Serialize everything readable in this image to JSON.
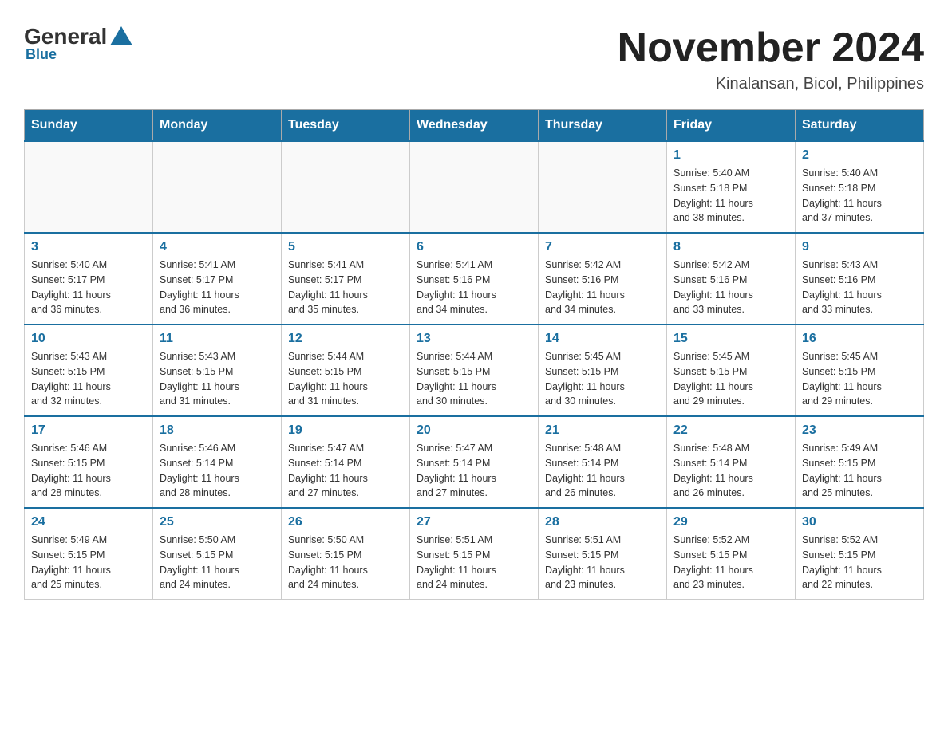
{
  "logo": {
    "general": "General",
    "blue": "Blue"
  },
  "title": "November 2024",
  "subtitle": "Kinalansan, Bicol, Philippines",
  "weekdays": [
    "Sunday",
    "Monday",
    "Tuesday",
    "Wednesday",
    "Thursday",
    "Friday",
    "Saturday"
  ],
  "weeks": [
    [
      {
        "day": "",
        "info": ""
      },
      {
        "day": "",
        "info": ""
      },
      {
        "day": "",
        "info": ""
      },
      {
        "day": "",
        "info": ""
      },
      {
        "day": "",
        "info": ""
      },
      {
        "day": "1",
        "info": "Sunrise: 5:40 AM\nSunset: 5:18 PM\nDaylight: 11 hours\nand 38 minutes."
      },
      {
        "day": "2",
        "info": "Sunrise: 5:40 AM\nSunset: 5:18 PM\nDaylight: 11 hours\nand 37 minutes."
      }
    ],
    [
      {
        "day": "3",
        "info": "Sunrise: 5:40 AM\nSunset: 5:17 PM\nDaylight: 11 hours\nand 36 minutes."
      },
      {
        "day": "4",
        "info": "Sunrise: 5:41 AM\nSunset: 5:17 PM\nDaylight: 11 hours\nand 36 minutes."
      },
      {
        "day": "5",
        "info": "Sunrise: 5:41 AM\nSunset: 5:17 PM\nDaylight: 11 hours\nand 35 minutes."
      },
      {
        "day": "6",
        "info": "Sunrise: 5:41 AM\nSunset: 5:16 PM\nDaylight: 11 hours\nand 34 minutes."
      },
      {
        "day": "7",
        "info": "Sunrise: 5:42 AM\nSunset: 5:16 PM\nDaylight: 11 hours\nand 34 minutes."
      },
      {
        "day": "8",
        "info": "Sunrise: 5:42 AM\nSunset: 5:16 PM\nDaylight: 11 hours\nand 33 minutes."
      },
      {
        "day": "9",
        "info": "Sunrise: 5:43 AM\nSunset: 5:16 PM\nDaylight: 11 hours\nand 33 minutes."
      }
    ],
    [
      {
        "day": "10",
        "info": "Sunrise: 5:43 AM\nSunset: 5:15 PM\nDaylight: 11 hours\nand 32 minutes."
      },
      {
        "day": "11",
        "info": "Sunrise: 5:43 AM\nSunset: 5:15 PM\nDaylight: 11 hours\nand 31 minutes."
      },
      {
        "day": "12",
        "info": "Sunrise: 5:44 AM\nSunset: 5:15 PM\nDaylight: 11 hours\nand 31 minutes."
      },
      {
        "day": "13",
        "info": "Sunrise: 5:44 AM\nSunset: 5:15 PM\nDaylight: 11 hours\nand 30 minutes."
      },
      {
        "day": "14",
        "info": "Sunrise: 5:45 AM\nSunset: 5:15 PM\nDaylight: 11 hours\nand 30 minutes."
      },
      {
        "day": "15",
        "info": "Sunrise: 5:45 AM\nSunset: 5:15 PM\nDaylight: 11 hours\nand 29 minutes."
      },
      {
        "day": "16",
        "info": "Sunrise: 5:45 AM\nSunset: 5:15 PM\nDaylight: 11 hours\nand 29 minutes."
      }
    ],
    [
      {
        "day": "17",
        "info": "Sunrise: 5:46 AM\nSunset: 5:15 PM\nDaylight: 11 hours\nand 28 minutes."
      },
      {
        "day": "18",
        "info": "Sunrise: 5:46 AM\nSunset: 5:14 PM\nDaylight: 11 hours\nand 28 minutes."
      },
      {
        "day": "19",
        "info": "Sunrise: 5:47 AM\nSunset: 5:14 PM\nDaylight: 11 hours\nand 27 minutes."
      },
      {
        "day": "20",
        "info": "Sunrise: 5:47 AM\nSunset: 5:14 PM\nDaylight: 11 hours\nand 27 minutes."
      },
      {
        "day": "21",
        "info": "Sunrise: 5:48 AM\nSunset: 5:14 PM\nDaylight: 11 hours\nand 26 minutes."
      },
      {
        "day": "22",
        "info": "Sunrise: 5:48 AM\nSunset: 5:14 PM\nDaylight: 11 hours\nand 26 minutes."
      },
      {
        "day": "23",
        "info": "Sunrise: 5:49 AM\nSunset: 5:15 PM\nDaylight: 11 hours\nand 25 minutes."
      }
    ],
    [
      {
        "day": "24",
        "info": "Sunrise: 5:49 AM\nSunset: 5:15 PM\nDaylight: 11 hours\nand 25 minutes."
      },
      {
        "day": "25",
        "info": "Sunrise: 5:50 AM\nSunset: 5:15 PM\nDaylight: 11 hours\nand 24 minutes."
      },
      {
        "day": "26",
        "info": "Sunrise: 5:50 AM\nSunset: 5:15 PM\nDaylight: 11 hours\nand 24 minutes."
      },
      {
        "day": "27",
        "info": "Sunrise: 5:51 AM\nSunset: 5:15 PM\nDaylight: 11 hours\nand 24 minutes."
      },
      {
        "day": "28",
        "info": "Sunrise: 5:51 AM\nSunset: 5:15 PM\nDaylight: 11 hours\nand 23 minutes."
      },
      {
        "day": "29",
        "info": "Sunrise: 5:52 AM\nSunset: 5:15 PM\nDaylight: 11 hours\nand 23 minutes."
      },
      {
        "day": "30",
        "info": "Sunrise: 5:52 AM\nSunset: 5:15 PM\nDaylight: 11 hours\nand 22 minutes."
      }
    ]
  ]
}
